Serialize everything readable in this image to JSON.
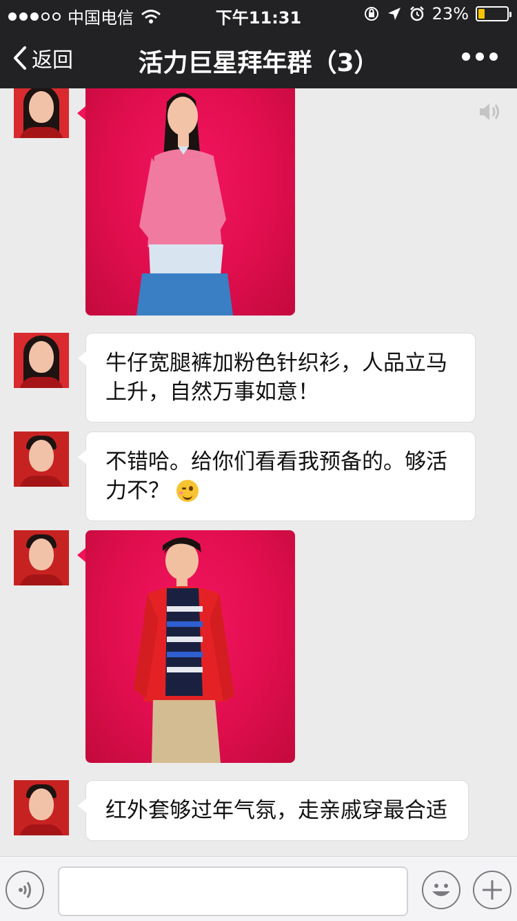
{
  "status_bar": {
    "carrier": "中国电信",
    "time": "下午11:31",
    "battery_percent": "23%",
    "battery_level": 0.23
  },
  "nav": {
    "back_label": "返回",
    "title": "活力巨星拜年群（3）"
  },
  "messages": [
    {
      "type": "image",
      "sender": "female",
      "description": "woman in pink sweater"
    },
    {
      "type": "text",
      "sender": "female",
      "text": "牛仔宽腿裤加粉色针织衫，人品立马上升，自然万事如意！"
    },
    {
      "type": "text",
      "sender": "male",
      "text": "不错哈。给你们看看我预备的。够活力不？",
      "emoji": "wink-face"
    },
    {
      "type": "image",
      "sender": "male",
      "description": "man in red jacket"
    },
    {
      "type": "text",
      "sender": "male",
      "text": "红外套够过年气氛，走亲戚穿最合适"
    }
  ],
  "icons": {
    "voice": "voice-icon",
    "emoji": "smile-icon",
    "plus": "plus-icon",
    "speaker": "speaker-icon",
    "more": "more-icon",
    "back": "chevron-left-icon"
  },
  "colors": {
    "nav_bg": "#222224",
    "photo_bg": "#e00e4e",
    "battery": "#f5c400",
    "chat_bg": "#ebebeb"
  }
}
